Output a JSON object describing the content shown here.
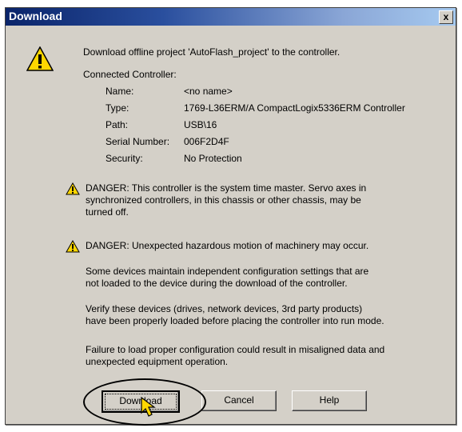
{
  "window": {
    "title": "Download",
    "close_label": "x"
  },
  "message": "Download offline project 'AutoFlash_project' to the controller.",
  "connected_label": "Connected Controller:",
  "controller": [
    {
      "label": "Name:",
      "value": "<no name>"
    },
    {
      "label": "Type:",
      "value": "1769-L36ERM/A CompactLogix5336ERM Controller"
    },
    {
      "label": "Path:",
      "value": "USB\\16"
    },
    {
      "label": "Serial Number:",
      "value": "006F2D4F"
    },
    {
      "label": "Security:",
      "value": "No Protection"
    }
  ],
  "danger1": {
    "line1": "DANGER: This controller is the system time master.  Servo axes in",
    "line2": "synchronized controllers, in this chassis or other chassis, may be",
    "line3": "turned off."
  },
  "danger2": "DANGER: Unexpected hazardous motion of machinery may occur.",
  "para1": {
    "line1": "Some devices maintain independent configuration settings that are",
    "line2": "not loaded to the device during the download of the controller."
  },
  "para2": {
    "line1": "Verify these devices (drives, network devices, 3rd party products)",
    "line2": "have been properly loaded before placing the controller into run mode."
  },
  "para3": {
    "line1": "Failure to load proper configuration could result in misaligned data and",
    "line2": "unexpected equipment operation."
  },
  "buttons": {
    "download": "Download",
    "cancel": "Cancel",
    "help": "Help"
  },
  "colors": {
    "title_start": "#0a246a",
    "title_end": "#a6caf0",
    "face": "#d4d0c8",
    "warning": "#ffd700"
  }
}
